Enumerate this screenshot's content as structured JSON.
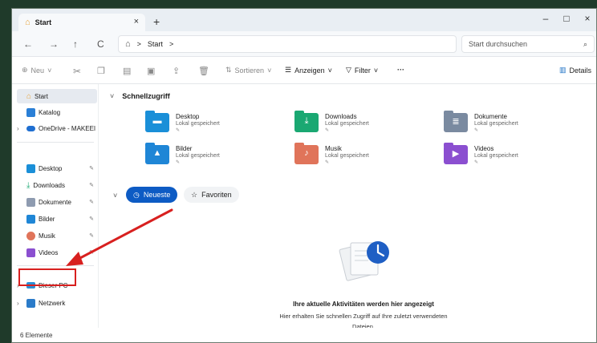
{
  "tab": {
    "title": "Start",
    "close": "×",
    "new": "+"
  },
  "window_controls": {
    "minimize": "–",
    "maximize": "□",
    "close": "×"
  },
  "nav": {
    "back": "←",
    "forward": "→",
    "up": "↑",
    "refresh": "C",
    "home_icon": "⌂",
    "crumb_sep": ">",
    "crumb": "Start",
    "crumb_end": ">"
  },
  "search": {
    "placeholder": "Start durchsuchen",
    "icon": "⌕"
  },
  "toolbar": {
    "new_label": "Neu",
    "sort_label": "Sortieren",
    "view_label": "Anzeigen",
    "filter_label": "Filter",
    "more_label": "···",
    "details_label": "Details"
  },
  "sidebar": {
    "items": [
      {
        "label": "Start"
      },
      {
        "label": "Katalog"
      },
      {
        "label": "OneDrive - MAKEEI"
      },
      {
        "label": "Desktop"
      },
      {
        "label": "Downloads"
      },
      {
        "label": "Dokumente"
      },
      {
        "label": "Bilder"
      },
      {
        "label": "Musik"
      },
      {
        "label": "Videos"
      },
      {
        "label": "Dieser PC"
      },
      {
        "label": "Netzwerk"
      }
    ]
  },
  "quick_access": {
    "title": "Schnellzugriff",
    "items": [
      {
        "name": "Desktop",
        "sub": "Lokal gespeichert",
        "color": "#1a8fd8"
      },
      {
        "name": "Downloads",
        "sub": "Lokal gespeichert",
        "color": "#1aa872"
      },
      {
        "name": "Dokumente",
        "sub": "Lokal gespeichert",
        "color": "#7a8aa0"
      },
      {
        "name": "Bilder",
        "sub": "Lokal gespeichert",
        "color": "#1f86d6"
      },
      {
        "name": "Musik",
        "sub": "Lokal gespeichert",
        "color": "#e0745a"
      },
      {
        "name": "Videos",
        "sub": "Lokal gespeichert",
        "color": "#8b4fd0"
      }
    ]
  },
  "recent": {
    "tab_recent": "Neueste",
    "tab_favorites": "Favoriten",
    "empty_title": "Ihre aktuelle Aktivitäten werden hier angezeigt",
    "empty_desc_line1": "Hier erhalten Sie schnellen Zugriff auf Ihre zuletzt verwendeten",
    "empty_desc_line2": "Dateien."
  },
  "status": {
    "count": "6 Elemente"
  },
  "colors": {
    "accent": "#0d5bc4",
    "highlight": "#d8201f"
  }
}
